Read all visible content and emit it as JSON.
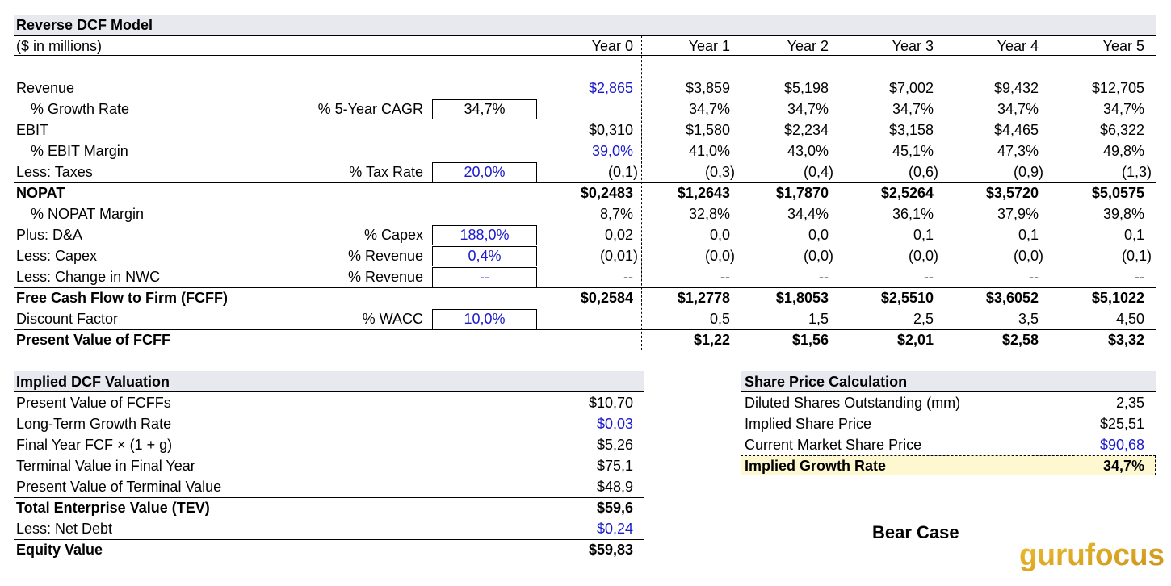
{
  "title": "Reverse DCF Model",
  "units": "($ in millions)",
  "years": [
    "Year 0",
    "Year 1",
    "Year 2",
    "Year 3",
    "Year 4",
    "Year 5"
  ],
  "rows": [
    {
      "label": "Revenue",
      "assumption_label": "",
      "assumption_value": "",
      "values": [
        "$2,865",
        "$3,859",
        "$5,198",
        "$7,002",
        "$9,432",
        "$12,705"
      ]
    },
    {
      "label": "% Growth Rate",
      "assumption_label": "% 5-Year CAGR",
      "assumption_value": "34,7%",
      "values": [
        "",
        "34,7%",
        "34,7%",
        "34,7%",
        "34,7%",
        "34,7%"
      ]
    },
    {
      "label": "EBIT",
      "assumption_label": "",
      "assumption_value": "",
      "values": [
        "$0,310",
        "$1,580",
        "$2,234",
        "$3,158",
        "$4,465",
        "$6,322"
      ]
    },
    {
      "label": "% EBIT Margin",
      "assumption_label": "",
      "assumption_value": "",
      "values": [
        "39,0%",
        "41,0%",
        "43,0%",
        "45,1%",
        "47,3%",
        "49,8%"
      ]
    },
    {
      "label": "Less: Taxes",
      "assumption_label": "% Tax Rate",
      "assumption_value": "20,0%",
      "values": [
        "(0,1)",
        "(0,3)",
        "(0,4)",
        "(0,6)",
        "(0,9)",
        "(1,3)"
      ]
    },
    {
      "label": "NOPAT",
      "assumption_label": "",
      "assumption_value": "",
      "values": [
        "$0,2483",
        "$1,2643",
        "$1,7870",
        "$2,5264",
        "$3,5720",
        "$5,0575"
      ]
    },
    {
      "label": "% NOPAT Margin",
      "assumption_label": "",
      "assumption_value": "",
      "values": [
        "8,7%",
        "32,8%",
        "34,4%",
        "36,1%",
        "37,9%",
        "39,8%"
      ]
    },
    {
      "label": "Plus: D&A",
      "assumption_label": "% Capex",
      "assumption_value": "188,0%",
      "values": [
        "0,02",
        "0,0",
        "0,0",
        "0,1",
        "0,1",
        "0,1"
      ]
    },
    {
      "label": "Less: Capex",
      "assumption_label": "% Revenue",
      "assumption_value": "0,4%",
      "values": [
        "(0,01)",
        "(0,0)",
        "(0,0)",
        "(0,0)",
        "(0,0)",
        "(0,1)"
      ]
    },
    {
      "label": "Less: Change in NWC",
      "assumption_label": "% Revenue",
      "assumption_value": "--",
      "values": [
        "--",
        "--",
        "--",
        "--",
        "--",
        "--"
      ]
    },
    {
      "label": "Free Cash Flow to Firm (FCFF)",
      "assumption_label": "",
      "assumption_value": "",
      "values": [
        "$0,2584",
        "$1,2778",
        "$1,8053",
        "$2,5510",
        "$3,6052",
        "$5,1022"
      ]
    },
    {
      "label": "Discount Factor",
      "assumption_label": "% WACC",
      "assumption_value": "10,0%",
      "values": [
        "",
        "0,5",
        "1,5",
        "2,5",
        "3,5",
        "4,50"
      ]
    },
    {
      "label": "Present Value of FCFF",
      "assumption_label": "",
      "assumption_value": "",
      "values": [
        "",
        "$1,22",
        "$1,56",
        "$2,01",
        "$2,58",
        "$3,32"
      ]
    }
  ],
  "implied_dcf": {
    "title": "Implied DCF Valuation",
    "rows": [
      {
        "label": "Present Value of FCFFs",
        "value": "$10,70"
      },
      {
        "label": "Long-Term Growth Rate",
        "value": "$0,03"
      },
      {
        "label": "Final Year FCF × (1 + g)",
        "value": "$5,26"
      },
      {
        "label": "Terminal Value in Final Year",
        "value": "$75,1"
      },
      {
        "label": "Present Value of Terminal Value",
        "value": "$48,9"
      },
      {
        "label": "Total Enterprise Value (TEV)",
        "value": "$59,6"
      },
      {
        "label": "Less: Net Debt",
        "value": "$0,24"
      },
      {
        "label": "Equity Value",
        "value": "$59,83"
      }
    ]
  },
  "share_price": {
    "title": "Share Price Calculation",
    "rows": [
      {
        "label": "Diluted Shares Outstanding (mm)",
        "value": "2,35"
      },
      {
        "label": "Implied Share Price",
        "value": "$25,51"
      },
      {
        "label": "Current Market Share Price",
        "value": "$90,68"
      },
      {
        "label": "Implied Growth Rate",
        "value": "34,7%"
      }
    ]
  },
  "scenario": "Bear Case",
  "logo_text": "gurufocus",
  "colors": {
    "input_blue": "#1a1acc",
    "header_band": "#e8e9ef",
    "highlight": "#fdf8cf",
    "logo_gold": "#d9a21b"
  }
}
